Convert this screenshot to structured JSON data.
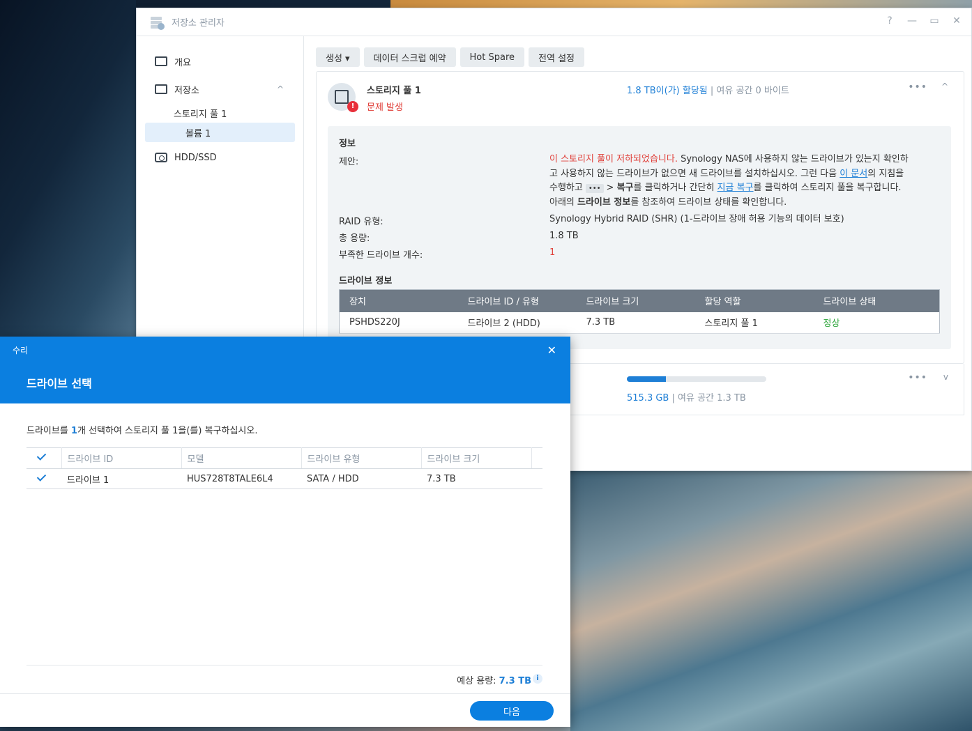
{
  "window": {
    "title": "저장소 관리자",
    "controls": [
      "?",
      "—",
      "▭",
      "✕"
    ]
  },
  "sidebar": {
    "items": [
      {
        "label": "개요",
        "icon": "overview-icon"
      },
      {
        "label": "저장소",
        "icon": "storage-icon",
        "expanded": true
      },
      {
        "label": "HDD/SSD",
        "icon": "hdd-icon"
      }
    ],
    "sub1": "스토리지 풀 1",
    "sub2": "볼륨 1",
    "chevron": "^"
  },
  "toolbar": {
    "create": "생성 ▾",
    "scrub": "데이터 스크럽 예약",
    "hotspare": "Hot Spare",
    "global": "전역 설정"
  },
  "pool": {
    "name": "스토리지 풀 1",
    "status": "문제 발생",
    "alloc_value": "1.8 TB이(가) 할당됨",
    "alloc_sep": "|",
    "alloc_free": "여유 공간 0 바이트",
    "dots": "•••",
    "caret": "^",
    "info_title": "정보",
    "suggest_label": "제안:",
    "suggest_red": "이 스토리지 풀이 저하되었습니다.",
    "suggest_1": " Synology NAS에 사용하지 않는 드라이브가 있는지 확인하",
    "suggest_2a": "고 사용하지 않는 드라이브가 없으면 새 드라이브를 설치하십시오. 그런 다음 ",
    "suggest_link1": "이 문서",
    "suggest_2b": "의 지침을",
    "suggest_3a": "수행하고",
    "suggest_kbd": "•••",
    "suggest_3b": "> ",
    "suggest_3c": "복구",
    "suggest_3d": "를 클릭하거나 간단히 ",
    "suggest_link2": "지금 복구",
    "suggest_3e": "를 클릭하여 스토리지 풀을 복구합니다.",
    "suggest_4a": "아래의 ",
    "suggest_4b": "드라이브 정보",
    "suggest_4c": "를 참조하여 드라이브 상태를 확인합니다.",
    "raid_label": "RAID 유형:",
    "raid_value": "Synology Hybrid RAID (SHR) (1-드라이브 장애 허용 기능의 데이터 보호)",
    "cap_label": "총 용량:",
    "cap_value": "1.8 TB",
    "missing_label": "부족한 드라이브 개수:",
    "missing_value": "1",
    "drive_title": "드라이브 정보",
    "table_headers": [
      "장치",
      "드라이브 ID / 유형",
      "드라이브 크기",
      "할당 역할",
      "드라이브 상태"
    ],
    "table_row": [
      "PSHDS220J",
      "드라이브 2 (HDD)",
      "7.3 TB",
      "스토리지 풀 1",
      "정상"
    ]
  },
  "volume": {
    "used": "515.3 GB",
    "sep": "|",
    "free": "여유 공간 1.3 TB",
    "usage_fraction": 0.28,
    "dots": "•••",
    "caret": "v"
  },
  "dialog": {
    "small_title": "수리",
    "title": "드라이브 선택",
    "close": "✕",
    "msg_a": "드라이브를 ",
    "msg_b": "1",
    "msg_c": "개 선택하여 스토리지 풀 1을(를) 복구하십시오.",
    "headers": [
      "드라이브 ID",
      "모델",
      "드라이브 유형",
      "드라이브 크기"
    ],
    "row": [
      "드라이브 1",
      "HUS728T8TALE6L4",
      "SATA / HDD",
      "7.3 TB"
    ],
    "est_label": "예상 용량: ",
    "est_value": "7.3 TB",
    "info": "i",
    "next": "다음"
  }
}
